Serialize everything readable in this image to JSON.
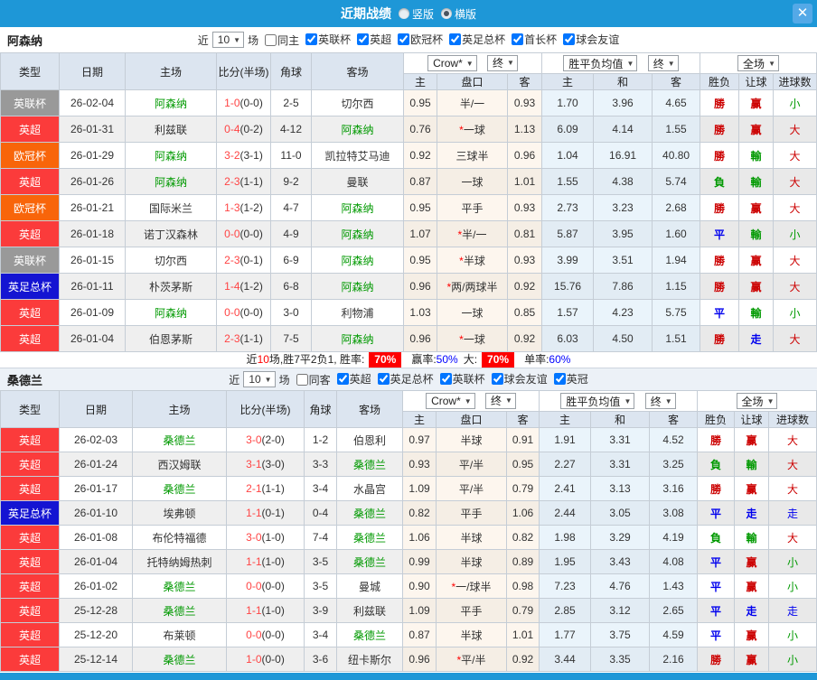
{
  "window": {
    "title": "近期战绩",
    "view_vertical": "竖版",
    "view_horizontal": "横版",
    "close": "✕"
  },
  "filter_labels": {
    "near": "近",
    "matches": "场"
  },
  "dropdowns": {
    "source": "Crow*",
    "final": "终",
    "avg": "胜平负均值",
    "scope": "全场"
  },
  "table_headers": {
    "type": "类型",
    "date": "日期",
    "home": "主场",
    "score": "比分(半场)",
    "corner": "角球",
    "away": "客场",
    "h": "主",
    "handicap": "盘口",
    "a": "客",
    "avg_h": "主",
    "avg_d": "和",
    "avg_a": "客",
    "result": "胜负",
    "let_ball": "让球",
    "goals": "进球数"
  },
  "type_colors": {
    "英超": "#fb3b3b",
    "英联杯": "#999999",
    "欧冠杯": "#f8650a",
    "英足总杯": "#1414d2",
    "英冠": "#fb3b3b"
  },
  "result_colors": {
    "勝": "red",
    "赢": "red",
    "大": "red",
    "負": "green",
    "輸": "green",
    "小": "green",
    "平": "blue",
    "走": "blue"
  },
  "sections": [
    {
      "team": "阿森纳",
      "count": "10",
      "same_label": "同主",
      "same_checked": false,
      "leagues": [
        "英联杯",
        "英超",
        "欧冠杯",
        "英足总杯",
        "首长杯",
        "球会友谊"
      ],
      "rows": [
        {
          "type": "英联杯",
          "date": "26-02-04",
          "home": "阿森纳",
          "score": "1-0",
          "half": "(0-0)",
          "corner": "2-5",
          "away": "切尔西",
          "oh": "0.95",
          "cap": "半/一",
          "oa": "0.93",
          "ah": "1.70",
          "ad": "3.96",
          "aa": "4.65",
          "res": "勝",
          "let": "赢",
          "goal": "小"
        },
        {
          "type": "英超",
          "date": "26-01-31",
          "home": "利兹联",
          "score": "0-4",
          "half": "(0-2)",
          "corner": "4-12",
          "away": "阿森纳",
          "oh": "0.76",
          "cap": "*一球",
          "oa": "1.13",
          "ah": "6.09",
          "ad": "4.14",
          "aa": "1.55",
          "res": "勝",
          "let": "赢",
          "goal": "大"
        },
        {
          "type": "欧冠杯",
          "date": "26-01-29",
          "home": "阿森纳",
          "score": "3-2",
          "half": "(3-1)",
          "corner": "11-0",
          "away": "凯拉特艾马迪",
          "oh": "0.92",
          "cap": "三球半",
          "oa": "0.96",
          "ah": "1.04",
          "ad": "16.91",
          "aa": "40.80",
          "res": "勝",
          "let": "輸",
          "goal": "大"
        },
        {
          "type": "英超",
          "date": "26-01-26",
          "home": "阿森纳",
          "score": "2-3",
          "half": "(1-1)",
          "corner": "9-2",
          "away": "曼联",
          "oh": "0.87",
          "cap": "一球",
          "oa": "1.01",
          "ah": "1.55",
          "ad": "4.38",
          "aa": "5.74",
          "res": "負",
          "let": "輸",
          "goal": "大"
        },
        {
          "type": "欧冠杯",
          "date": "26-01-21",
          "home": "国际米兰",
          "score": "1-3",
          "half": "(1-2)",
          "corner": "4-7",
          "away": "阿森纳",
          "oh": "0.95",
          "cap": "平手",
          "oa": "0.93",
          "ah": "2.73",
          "ad": "3.23",
          "aa": "2.68",
          "res": "勝",
          "let": "赢",
          "goal": "大"
        },
        {
          "type": "英超",
          "date": "26-01-18",
          "home": "诺丁汉森林",
          "score": "0-0",
          "half": "(0-0)",
          "corner": "4-9",
          "away": "阿森纳",
          "oh": "1.07",
          "cap": "*半/一",
          "oa": "0.81",
          "ah": "5.87",
          "ad": "3.95",
          "aa": "1.60",
          "res": "平",
          "let": "輸",
          "goal": "小"
        },
        {
          "type": "英联杯",
          "date": "26-01-15",
          "home": "切尔西",
          "score": "2-3",
          "half": "(0-1)",
          "corner": "6-9",
          "away": "阿森纳",
          "oh": "0.95",
          "cap": "*半球",
          "oa": "0.93",
          "ah": "3.99",
          "ad": "3.51",
          "aa": "1.94",
          "res": "勝",
          "let": "赢",
          "goal": "大"
        },
        {
          "type": "英足总杯",
          "date": "26-01-11",
          "home": "朴茨茅斯",
          "score": "1-4",
          "half": "(1-2)",
          "corner": "6-8",
          "away": "阿森纳",
          "oh": "0.96",
          "cap": "*两/两球半",
          "oa": "0.92",
          "ah": "15.76",
          "ad": "7.86",
          "aa": "1.15",
          "res": "勝",
          "let": "赢",
          "goal": "大"
        },
        {
          "type": "英超",
          "date": "26-01-09",
          "home": "阿森纳",
          "score": "0-0",
          "half": "(0-0)",
          "corner": "3-0",
          "away": "利物浦",
          "oh": "1.03",
          "cap": "一球",
          "oa": "0.85",
          "ah": "1.57",
          "ad": "4.23",
          "aa": "5.75",
          "res": "平",
          "let": "輸",
          "goal": "小"
        },
        {
          "type": "英超",
          "date": "26-01-04",
          "home": "伯恩茅斯",
          "score": "2-3",
          "half": "(1-1)",
          "corner": "7-5",
          "away": "阿森纳",
          "oh": "0.96",
          "cap": "*一球",
          "oa": "0.92",
          "ah": "6.03",
          "ad": "4.50",
          "aa": "1.51",
          "res": "勝",
          "let": "走",
          "goal": "大"
        }
      ],
      "summary": {
        "pre": "近",
        "count": "10",
        "mid": "场,胜7平2负1, 胜率:",
        "win_rate": "70%",
        "label_draw": "赢率:",
        "draw_rate": "50%",
        "label_big": "大:",
        "big_rate": "70%",
        "label_single": "单率:",
        "single_rate": "60%"
      }
    },
    {
      "team": "桑德兰",
      "count": "10",
      "same_label": "同客",
      "same_checked": false,
      "leagues": [
        "英超",
        "英足总杯",
        "英联杯",
        "球会友谊",
        "英冠"
      ],
      "rows": [
        {
          "type": "英超",
          "date": "26-02-03",
          "home": "桑德兰",
          "score": "3-0",
          "half": "(2-0)",
          "corner": "1-2",
          "away": "伯恩利",
          "oh": "0.97",
          "cap": "半球",
          "oa": "0.91",
          "ah": "1.91",
          "ad": "3.31",
          "aa": "4.52",
          "res": "勝",
          "let": "赢",
          "goal": "大"
        },
        {
          "type": "英超",
          "date": "26-01-24",
          "home": "西汉姆联",
          "score": "3-1",
          "half": "(3-0)",
          "corner": "3-3",
          "away": "桑德兰",
          "oh": "0.93",
          "cap": "平/半",
          "oa": "0.95",
          "ah": "2.27",
          "ad": "3.31",
          "aa": "3.25",
          "res": "負",
          "let": "輸",
          "goal": "大"
        },
        {
          "type": "英超",
          "date": "26-01-17",
          "home": "桑德兰",
          "score": "2-1",
          "half": "(1-1)",
          "corner": "3-4",
          "away": "水晶宫",
          "oh": "1.09",
          "cap": "平/半",
          "oa": "0.79",
          "ah": "2.41",
          "ad": "3.13",
          "aa": "3.16",
          "res": "勝",
          "let": "赢",
          "goal": "大"
        },
        {
          "type": "英足总杯",
          "date": "26-01-10",
          "home": "埃弗顿",
          "score": "1-1",
          "half": "(0-1)",
          "corner": "0-4",
          "away": "桑德兰",
          "oh": "0.82",
          "cap": "平手",
          "oa": "1.06",
          "ah": "2.44",
          "ad": "3.05",
          "aa": "3.08",
          "res": "平",
          "let": "走",
          "goal": "走"
        },
        {
          "type": "英超",
          "date": "26-01-08",
          "home": "布伦特福德",
          "score": "3-0",
          "half": "(1-0)",
          "corner": "7-4",
          "away": "桑德兰",
          "oh": "1.06",
          "cap": "半球",
          "oa": "0.82",
          "ah": "1.98",
          "ad": "3.29",
          "aa": "4.19",
          "res": "負",
          "let": "輸",
          "goal": "大"
        },
        {
          "type": "英超",
          "date": "26-01-04",
          "home": "托特纳姆热刺",
          "score": "1-1",
          "half": "(1-0)",
          "corner": "3-5",
          "away": "桑德兰",
          "oh": "0.99",
          "cap": "半球",
          "oa": "0.89",
          "ah": "1.95",
          "ad": "3.43",
          "aa": "4.08",
          "res": "平",
          "let": "赢",
          "goal": "小"
        },
        {
          "type": "英超",
          "date": "26-01-02",
          "home": "桑德兰",
          "score": "0-0",
          "half": "(0-0)",
          "corner": "3-5",
          "away": "曼城",
          "oh": "0.90",
          "cap": "*一/球半",
          "oa": "0.98",
          "ah": "7.23",
          "ad": "4.76",
          "aa": "1.43",
          "res": "平",
          "let": "赢",
          "goal": "小"
        },
        {
          "type": "英超",
          "date": "25-12-28",
          "home": "桑德兰",
          "score": "1-1",
          "half": "(1-0)",
          "corner": "3-9",
          "away": "利兹联",
          "oh": "1.09",
          "cap": "平手",
          "oa": "0.79",
          "ah": "2.85",
          "ad": "3.12",
          "aa": "2.65",
          "res": "平",
          "let": "走",
          "goal": "走"
        },
        {
          "type": "英超",
          "date": "25-12-20",
          "home": "布莱顿",
          "score": "0-0",
          "half": "(0-0)",
          "corner": "3-4",
          "away": "桑德兰",
          "oh": "0.87",
          "cap": "半球",
          "oa": "1.01",
          "ah": "1.77",
          "ad": "3.75",
          "aa": "4.59",
          "res": "平",
          "let": "赢",
          "goal": "小"
        },
        {
          "type": "英超",
          "date": "25-12-14",
          "home": "桑德兰",
          "score": "1-0",
          "half": "(0-0)",
          "corner": "3-6",
          "away": "纽卡斯尔",
          "oh": "0.96",
          "cap": "*平/半",
          "oa": "0.92",
          "ah": "3.44",
          "ad": "3.35",
          "aa": "2.16",
          "res": "勝",
          "let": "赢",
          "goal": "小"
        }
      ]
    }
  ]
}
